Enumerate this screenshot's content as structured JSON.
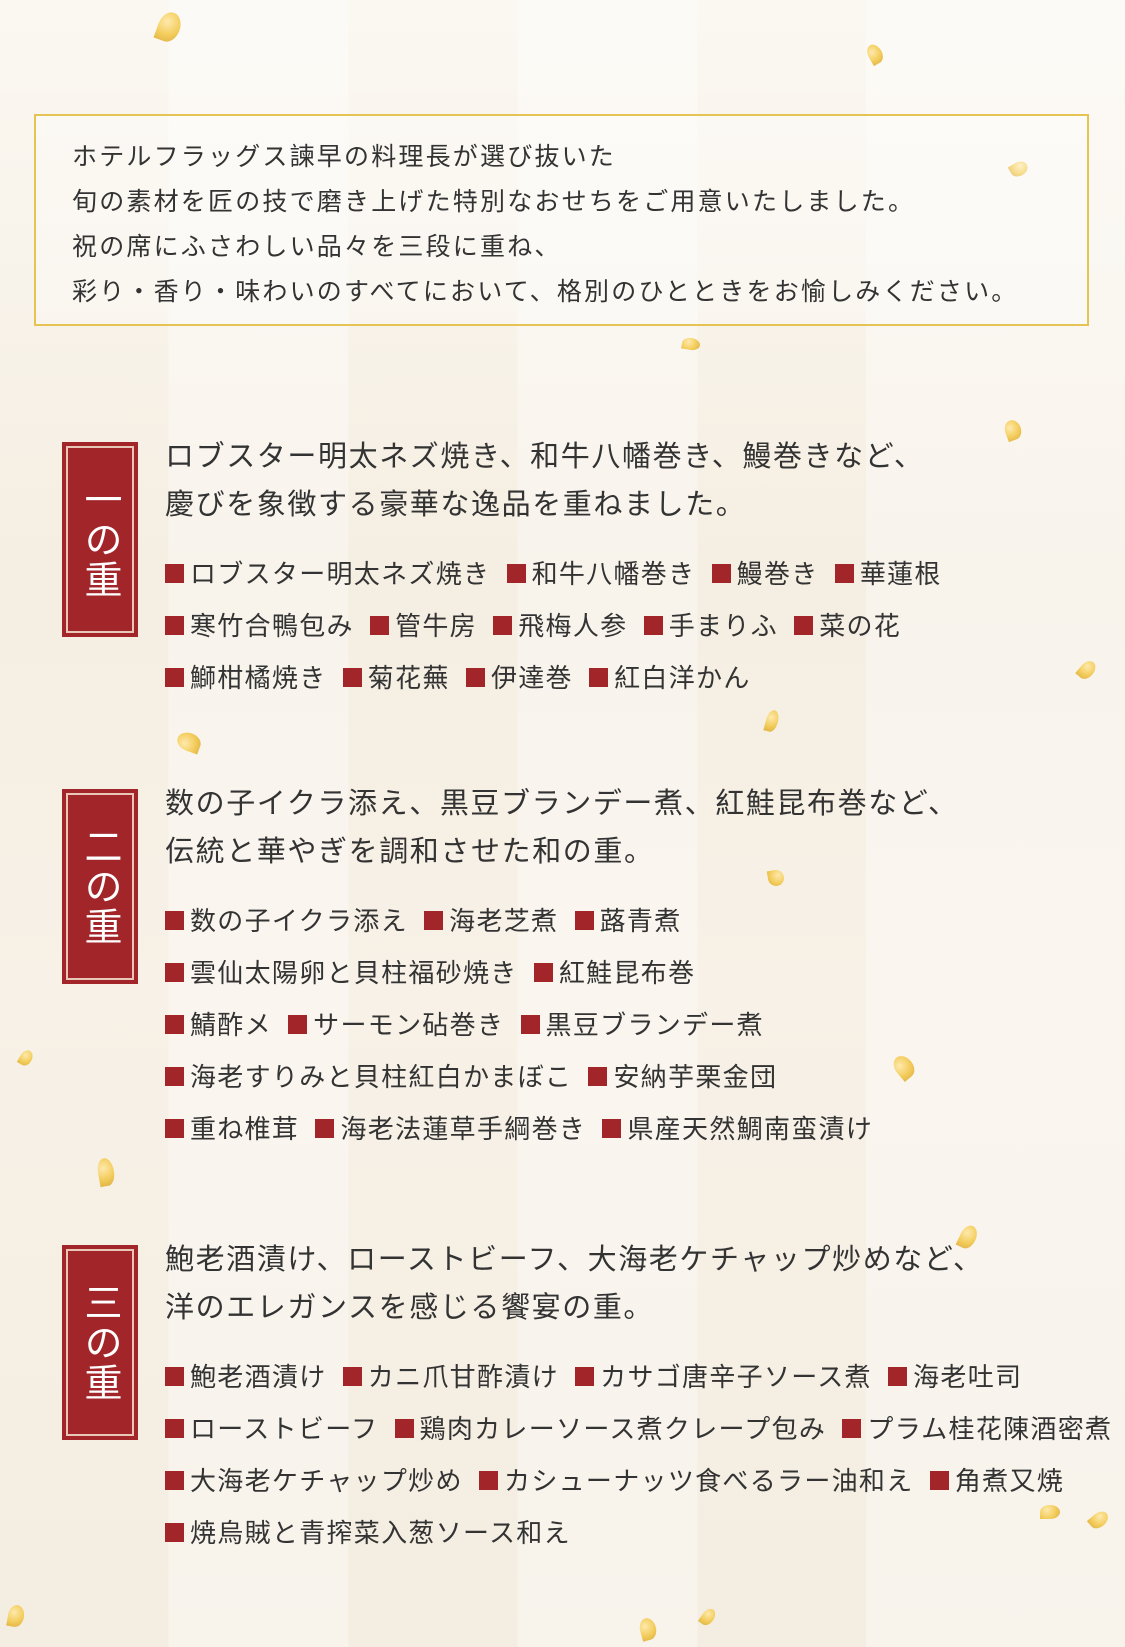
{
  "colors": {
    "accent_red": "#a2252a",
    "gold_border": "#e6c454",
    "petal_gold": "#f2c84b",
    "background": "#f8f3ea"
  },
  "intro": {
    "lines": [
      "ホテルフラッグス諫早の料理長が選び抜いた",
      "旬の素材を匠の技で磨き上げた特別なおせちをご用意いたしました。",
      "祝の席にふさわしい品々を三段に重ね、",
      "彩り・香り・味わいのすべてにおいて、格別のひとときをお愉しみください。"
    ]
  },
  "sections": [
    {
      "tag": "一の重",
      "desc": [
        "ロブスター明太ネズ焼き、和牛八幡巻き、鰻巻きなど、",
        "慶びを象徴する豪華な逸品を重ねました。"
      ],
      "item_lines": [
        [
          "ロブスター明太ネズ焼き",
          "和牛八幡巻き",
          "鰻巻き",
          "華蓮根"
        ],
        [
          "寒竹合鴨包み",
          "管牛房",
          "飛梅人参",
          "手まりふ",
          "菜の花"
        ],
        [
          "鰤柑橘焼き",
          "菊花蕪",
          "伊達巻",
          "紅白洋かん"
        ]
      ]
    },
    {
      "tag": "二の重",
      "desc": [
        "数の子イクラ添え、黒豆ブランデー煮、紅鮭昆布巻など、",
        "伝統と華やぎを調和させた和の重。"
      ],
      "item_lines": [
        [
          "数の子イクラ添え",
          "海老芝煮",
          "蕗青煮"
        ],
        [
          "雲仙太陽卵と貝柱福砂焼き",
          "紅鮭昆布巻"
        ],
        [
          "鯖酢メ",
          "サーモン砧巻き",
          "黒豆ブランデー煮"
        ],
        [
          "海老すりみと貝柱紅白かまぼこ",
          "安納芋栗金団"
        ],
        [
          "重ね椎茸",
          "海老法蓮草手綱巻き",
          "県産天然鯛南蛮漬け"
        ]
      ]
    },
    {
      "tag": "三の重",
      "desc": [
        "鮑老酒漬け、ローストビーフ、大海老ケチャップ炒めなど、",
        "洋のエレガンスを感じる饗宴の重。"
      ],
      "item_lines": [
        [
          "鮑老酒漬け",
          "カニ爪甘酢漬け",
          "カサゴ唐辛子ソース煮",
          "海老吐司"
        ],
        [
          "ローストビーフ",
          "鶏肉カレーソース煮クレープ包み",
          "プラム桂花陳酒密煮"
        ],
        [
          "大海老ケチャップ炒め",
          "カシューナッツ食べるラー油和え",
          "角煮又焼"
        ],
        [
          "焼烏賊と青搾菜入葱ソース和え"
        ]
      ]
    }
  ]
}
